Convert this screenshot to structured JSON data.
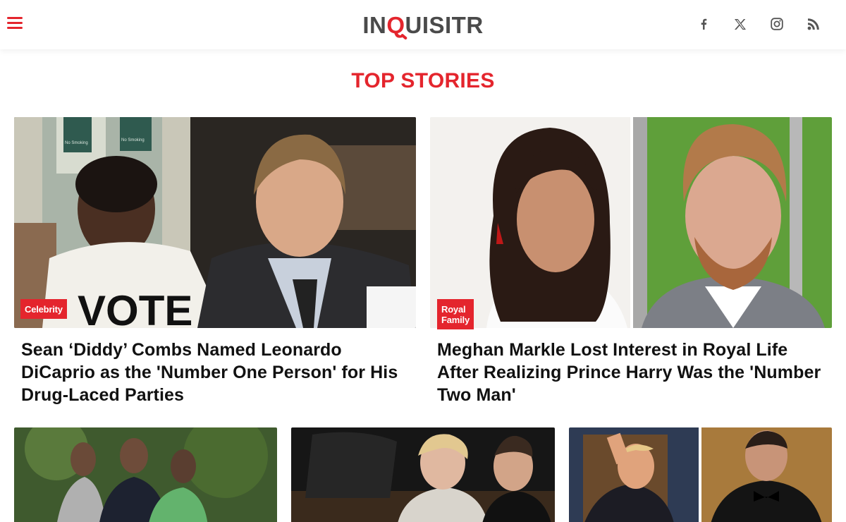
{
  "header": {
    "logo_text_1": "IN",
    "logo_q": "Q",
    "logo_text_2": "UISITR",
    "social": [
      {
        "name": "facebook-icon"
      },
      {
        "name": "x-icon"
      },
      {
        "name": "instagram-icon"
      },
      {
        "name": "rss-icon"
      }
    ]
  },
  "section": {
    "title": "TOP STORIES"
  },
  "stories": [
    {
      "category": "Celebrity",
      "headline": "Sean ‘Diddy’ Combs Named Leonardo DiCaprio as the 'Number One Person' for His Drug-Laced Parties"
    },
    {
      "category": "Royal Family",
      "headline": "Meghan Markle Lost Interest in Royal Life After Realizing Prince Harry Was the 'Number Two Man'"
    }
  ],
  "photo_text": {
    "no_smoking_1": "No Smoking",
    "no_smoking_2": "No Smoking",
    "shirt_text": "VOTE"
  },
  "colors": {
    "accent": "#e4252d",
    "logo_gray": "#4a4a4a"
  }
}
